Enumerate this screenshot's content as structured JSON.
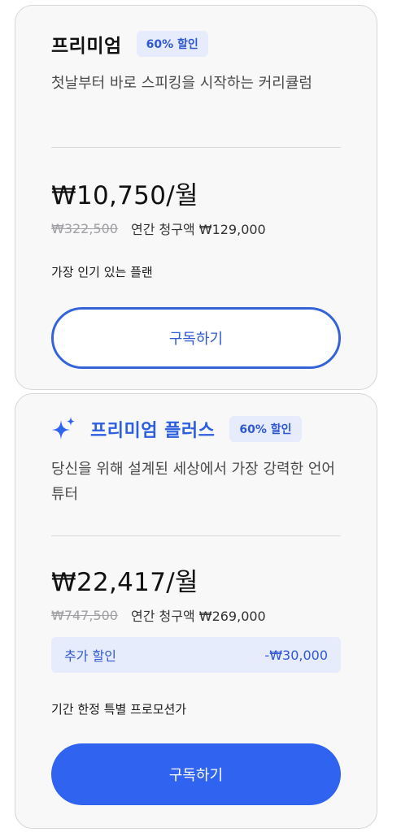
{
  "plans": [
    {
      "name": "프리미엄",
      "badge": "60% 할인",
      "description": "첫날부터 바로 스피킹을 시작하는 커리큘럼",
      "price": "₩10,750/월",
      "original_price": "₩322,500",
      "annual_billing": "연간 청구액 ₩129,000",
      "note": "가장 인기 있는 플랜",
      "cta": "구독하기"
    },
    {
      "icon": "sparkle-icon",
      "name": "프리미엄 플러스",
      "badge": "60% 할인",
      "description": "당신을 위해 설계된 세상에서 가장 강력한 언어 튜터",
      "price": "₩22,417/월",
      "original_price": "₩747,500",
      "annual_billing": "연간 청구액 ₩269,000",
      "extra_discount_label": "추가 할인",
      "extra_discount_value": "-₩30,000",
      "note": "기간 한정 특별 프로모션가",
      "cta": "구독하기"
    }
  ],
  "colors": {
    "accent": "#2f63f0",
    "badge_bg": "#e6ecfb",
    "card_bg": "#f8f8f9"
  }
}
